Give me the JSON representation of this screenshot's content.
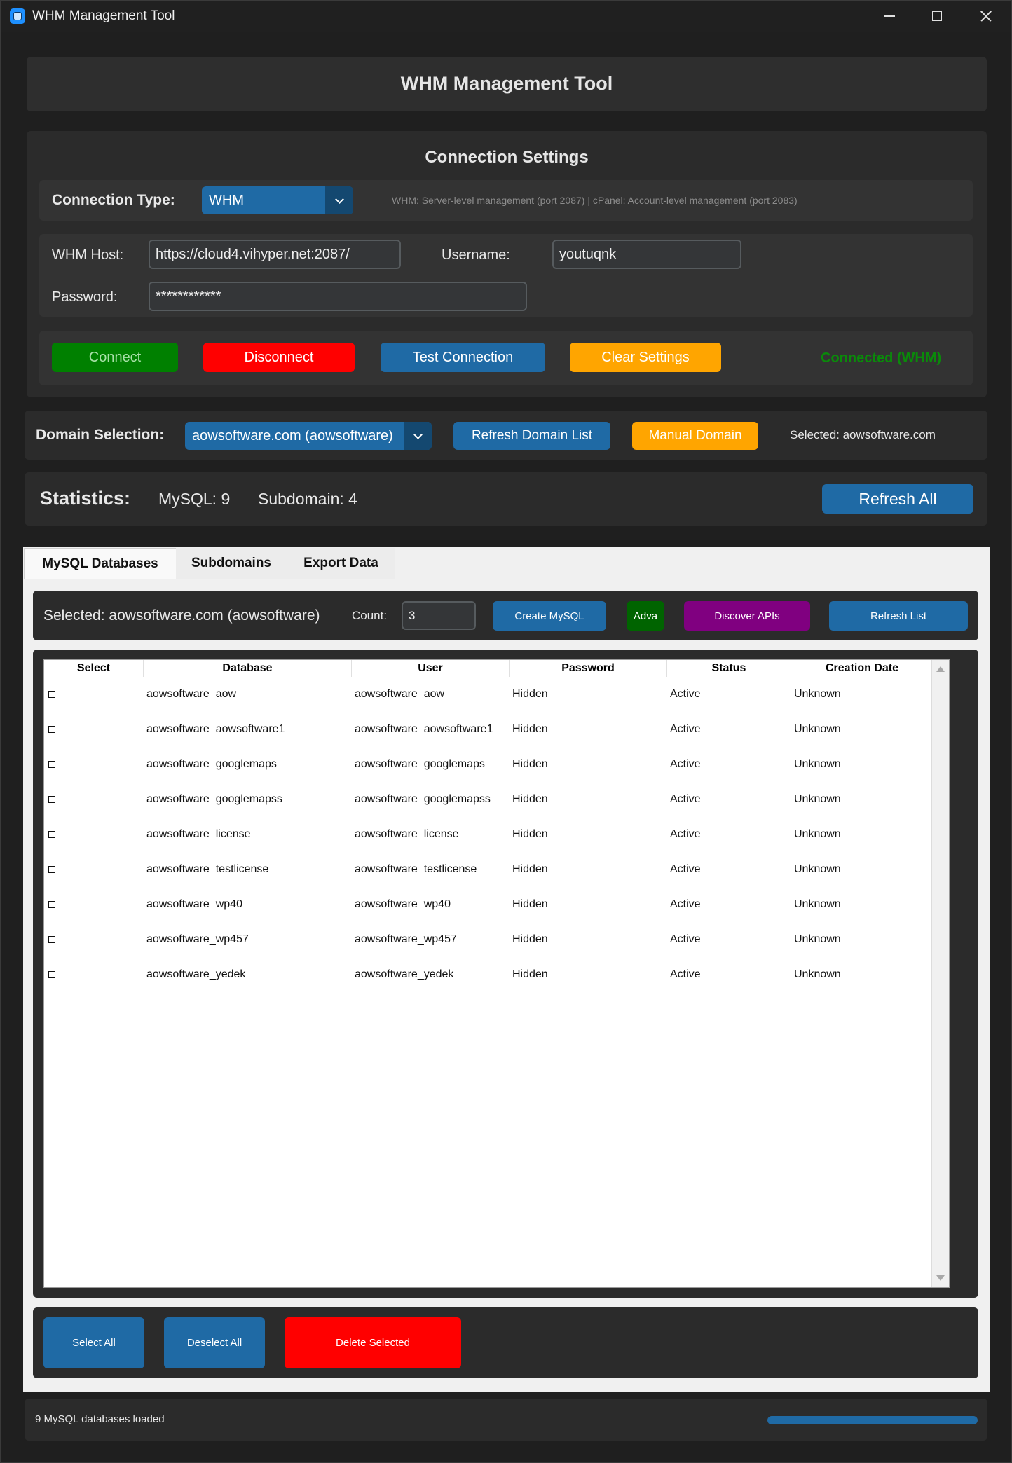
{
  "window": {
    "title": "WHM Management Tool"
  },
  "header": {
    "title": "WHM Management Tool"
  },
  "connection": {
    "title": "Connection Settings",
    "type_label": "Connection Type:",
    "type_value": "WHM",
    "type_hint": "WHM: Server-level management (port 2087) | cPanel: Account-level management (port 2083)",
    "host_label": "WHM Host:",
    "host_value": "https://cloud4.vihyper.net:2087/",
    "username_label": "Username:",
    "username_value": "youtuqnk",
    "password_label": "Password:",
    "password_value": "************",
    "buttons": {
      "connect": "Connect",
      "disconnect": "Disconnect",
      "test": "Test Connection",
      "clear": "Clear Settings"
    },
    "status": "Connected (WHM)"
  },
  "domain": {
    "label": "Domain Selection:",
    "value": "aowsoftware.com (aowsoftware)",
    "refresh": "Refresh Domain List",
    "manual": "Manual Domain",
    "selected": "Selected: aowsoftware.com"
  },
  "stats": {
    "label": "Statistics:",
    "mysql": "MySQL: 9",
    "subdomain": "Subdomain: 4",
    "refresh_all": "Refresh All"
  },
  "tabs": [
    "MySQL Databases",
    "Subdomains",
    "Export Data"
  ],
  "mysql": {
    "selected": "Selected: aowsoftware.com (aowsoftware)",
    "count_label": "Count:",
    "count_value": "3",
    "create": "Create MySQL",
    "adva": "Adva",
    "discover": "Discover APIs",
    "refresh_list": "Refresh List",
    "columns": [
      "Select",
      "Database",
      "User",
      "Password",
      "Status",
      "Creation Date"
    ],
    "rows": [
      [
        "aowsoftware_aow",
        "aowsoftware_aow",
        "Hidden",
        "Active",
        "Unknown"
      ],
      [
        "aowsoftware_aowsoftware1",
        "aowsoftware_aowsoftware1",
        "Hidden",
        "Active",
        "Unknown"
      ],
      [
        "aowsoftware_googlemaps",
        "aowsoftware_googlemaps",
        "Hidden",
        "Active",
        "Unknown"
      ],
      [
        "aowsoftware_googlemapss",
        "aowsoftware_googlemapss",
        "Hidden",
        "Active",
        "Unknown"
      ],
      [
        "aowsoftware_license",
        "aowsoftware_license",
        "Hidden",
        "Active",
        "Unknown"
      ],
      [
        "aowsoftware_testlicense",
        "aowsoftware_testlicense",
        "Hidden",
        "Active",
        "Unknown"
      ],
      [
        "aowsoftware_wp40",
        "aowsoftware_wp40",
        "Hidden",
        "Active",
        "Unknown"
      ],
      [
        "aowsoftware_wp457",
        "aowsoftware_wp457",
        "Hidden",
        "Active",
        "Unknown"
      ],
      [
        "aowsoftware_yedek",
        "aowsoftware_yedek",
        "Hidden",
        "Active",
        "Unknown"
      ]
    ],
    "select_all": "Select All",
    "deselect_all": "Deselect All",
    "delete_selected": "Delete Selected"
  },
  "status_bar": {
    "text": "9 MySQL databases loaded",
    "progress": 1.0
  },
  "colors": {
    "accent": "#1f6aa5",
    "connect": "#008000",
    "danger": "#ff0000",
    "warning": "#ffa500",
    "purple": "#800080",
    "status_ok": "#008000"
  }
}
